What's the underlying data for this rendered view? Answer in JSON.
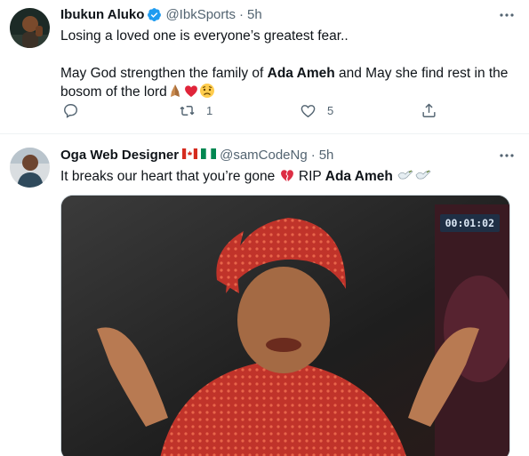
{
  "tweets": [
    {
      "display_name": "Ibukun Aluko",
      "handle": "@IbkSports",
      "separator": "·",
      "time": "5h",
      "line1": "Losing a loved one is everyone’s greatest fear..",
      "line2_pre": "May God strengthen the family of ",
      "line2_bold": "Ada Ameh",
      "line2_post": " and May she find rest in the",
      "line3": "bosom of the lord",
      "emojis": [
        "folded-hands",
        "red-heart",
        "worried-face"
      ],
      "retweets": "1",
      "likes": "5"
    },
    {
      "display_name": "Oga Web Designer",
      "flags": [
        "canada",
        "nigeria"
      ],
      "handle": "@samCodeNg",
      "separator": "·",
      "time": "5h",
      "text_pre": "It breaks our heart that you’re gone ",
      "text_mid": " RIP ",
      "text_bold": "Ada Ameh",
      "emojis": [
        "broken-heart",
        "dove",
        "dove"
      ],
      "media": {
        "timer": "00:01:02",
        "description_icon": "video-still-photo"
      }
    }
  ],
  "colors": {
    "verified": "#1d9bf0",
    "secondary_text": "#536471",
    "border": "#eff3f4"
  }
}
